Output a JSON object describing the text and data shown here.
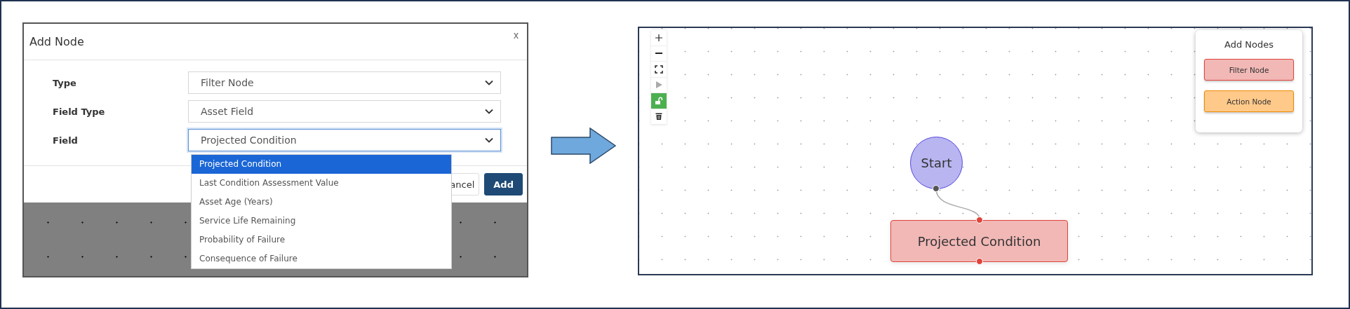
{
  "dialog": {
    "title": "Add Node",
    "close": "x",
    "fields": [
      {
        "label": "Type",
        "value": "Filter Node",
        "focused": false
      },
      {
        "label": "Field Type",
        "value": "Asset Field",
        "focused": false
      },
      {
        "label": "Field",
        "value": "Projected Condition",
        "focused": true
      }
    ],
    "dropdown": [
      {
        "label": "Projected Condition",
        "selected": true
      },
      {
        "label": "Last Condition Assessment Value",
        "selected": false
      },
      {
        "label": "Asset Age (Years)",
        "selected": false
      },
      {
        "label": "Service Life Remaining",
        "selected": false
      },
      {
        "label": "Probability of Failure",
        "selected": false
      },
      {
        "label": "Consequence of Failure",
        "selected": false
      }
    ],
    "buttons": [
      {
        "label": "ancel",
        "kind": "secondary"
      },
      {
        "label": "Add",
        "kind": "primary"
      }
    ]
  },
  "canvas": {
    "toolbar": [
      {
        "kind": "plus",
        "disabled": false,
        "active": false
      },
      {
        "kind": "minus",
        "disabled": false,
        "active": false
      },
      {
        "kind": "fit",
        "disabled": false,
        "active": false
      },
      {
        "kind": "play",
        "disabled": true,
        "active": false
      },
      {
        "kind": "unlock",
        "disabled": false,
        "active": true
      },
      {
        "kind": "trash",
        "disabled": false,
        "active": false
      }
    ],
    "nodes": [
      {
        "kind": "start",
        "label": "Start"
      },
      {
        "kind": "filter",
        "label": "Projected Condition"
      }
    ],
    "palette": {
      "title": "Add Nodes",
      "items": [
        {
          "kind": "filter",
          "label": "Filter Node"
        },
        {
          "kind": "action",
          "label": "Action Node"
        }
      ]
    }
  }
}
